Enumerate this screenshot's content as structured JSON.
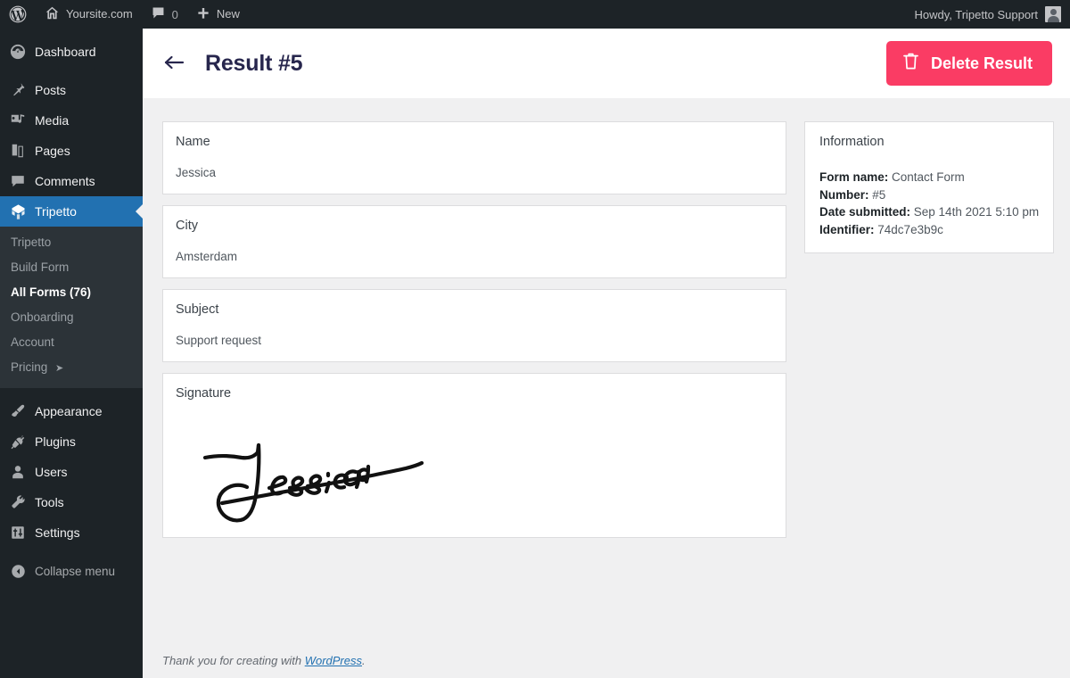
{
  "adminbar": {
    "logo_icon": "wordpress-logo-icon",
    "site_icon": "home-icon",
    "site_name": "Yoursite.com",
    "comments_icon": "comment-bubble-icon",
    "comments_count": "0",
    "new_icon": "plus-icon",
    "new_label": "New",
    "howdy": "Howdy, Tripetto Support",
    "avatar_icon": "user-avatar-icon"
  },
  "sidebar": {
    "items": [
      {
        "label": "Dashboard",
        "icon": "dashboard-gauge-icon",
        "current": false
      },
      {
        "label": "Posts",
        "icon": "pin-icon",
        "current": false
      },
      {
        "label": "Media",
        "icon": "media-music-icon",
        "current": false
      },
      {
        "label": "Pages",
        "icon": "pages-icon",
        "current": false
      },
      {
        "label": "Comments",
        "icon": "comment-bubble-icon",
        "current": false
      },
      {
        "label": "Tripetto",
        "icon": "tripetto-logo-icon",
        "current": true
      }
    ],
    "submenu": [
      {
        "label": "Tripetto",
        "current": false,
        "external": false
      },
      {
        "label": "Build Form",
        "current": false,
        "external": false
      },
      {
        "label": "All Forms (76)",
        "current": true,
        "external": false
      },
      {
        "label": "Onboarding",
        "current": false,
        "external": false
      },
      {
        "label": "Account",
        "current": false,
        "external": false
      },
      {
        "label": "Pricing",
        "current": false,
        "external": true
      }
    ],
    "items_bottom": [
      {
        "label": "Appearance",
        "icon": "paintbrush-icon"
      },
      {
        "label": "Plugins",
        "icon": "plug-icon"
      },
      {
        "label": "Users",
        "icon": "user-icon"
      },
      {
        "label": "Tools",
        "icon": "wrench-icon"
      },
      {
        "label": "Settings",
        "icon": "sliders-icon"
      }
    ],
    "collapse": {
      "label": "Collapse menu",
      "icon": "collapse-arrow-icon"
    },
    "external_arrow_glyph": "➤",
    "accent_current": "#2271b1",
    "background": "#1d2327",
    "submenu_background": "#2c3338"
  },
  "header": {
    "back_icon": "arrow-left-icon",
    "title": "Result #5",
    "delete_icon": "trash-icon",
    "delete_label": "Delete Result",
    "delete_color": "#fa3c64",
    "title_color": "#27264d"
  },
  "fields": [
    {
      "title": "Name",
      "value": "Jessica"
    },
    {
      "title": "City",
      "value": "Amsterdam"
    },
    {
      "title": "Subject",
      "value": "Support request"
    }
  ],
  "signature": {
    "title": "Signature",
    "alt": "handwritten signature reading Jessica"
  },
  "information": {
    "title": "Information",
    "rows": [
      {
        "label": "Form name:",
        "value": "Contact Form"
      },
      {
        "label": "Number:",
        "value": "#5"
      },
      {
        "label": "Date submitted:",
        "value": "Sep 14th 2021 5:10 pm"
      },
      {
        "label": "Identifier:",
        "value": "74dc7e3b9c"
      }
    ]
  },
  "footer": {
    "prefix": "Thank you for creating with ",
    "link": "WordPress",
    "suffix": "."
  }
}
